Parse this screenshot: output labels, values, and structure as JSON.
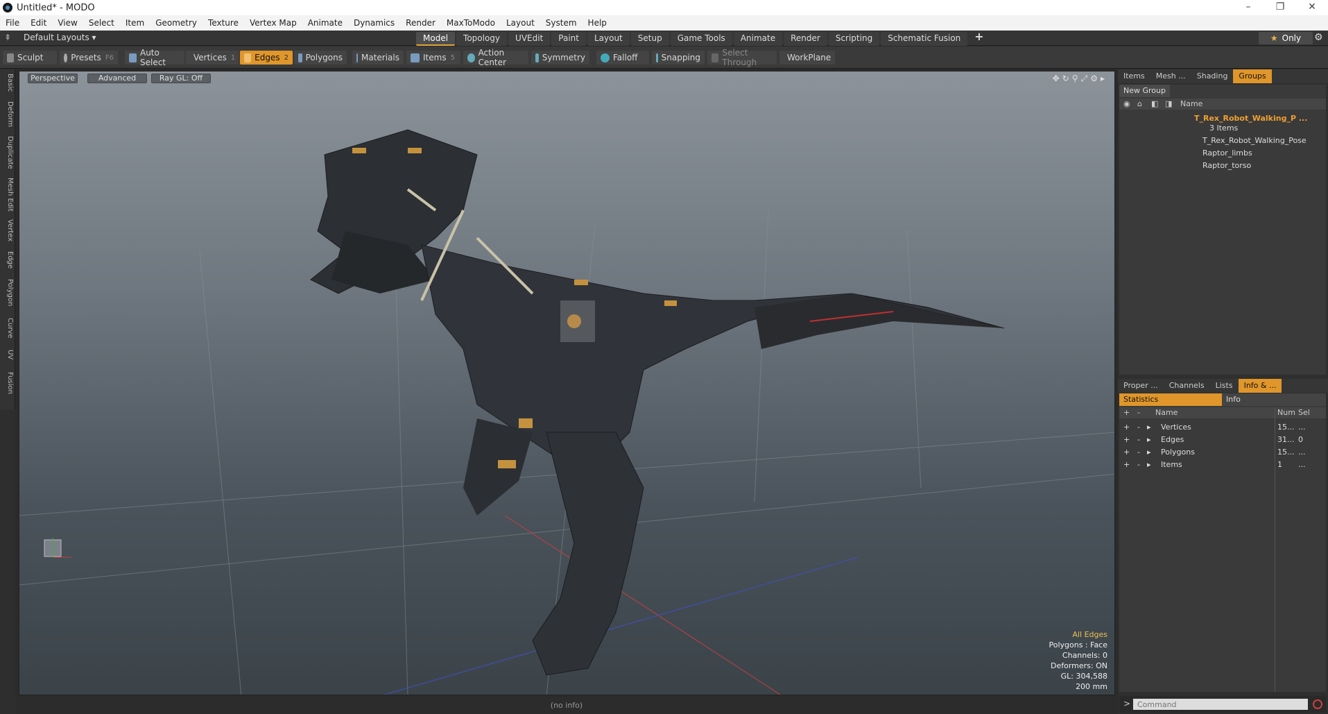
{
  "window": {
    "title": "Untitled* - MODO",
    "min": "–",
    "max": "❐",
    "close": "✕"
  },
  "menu": [
    "File",
    "Edit",
    "View",
    "Select",
    "Item",
    "Geometry",
    "Texture",
    "Vertex Map",
    "Animate",
    "Dynamics",
    "Render",
    "MaxToModo",
    "Layout",
    "System",
    "Help"
  ],
  "layouts": {
    "label": "Default Layouts ▾",
    "tabs": [
      "Model",
      "Topology",
      "UVEdit",
      "Paint",
      "Layout",
      "Setup",
      "Game Tools",
      "Animate",
      "Render",
      "Scripting",
      "Schematic Fusion"
    ],
    "active": "Model",
    "add": "+",
    "only": "Only"
  },
  "toolbar": {
    "sculpt": "Sculpt",
    "presets": "Presets",
    "presets_key": "F6",
    "auto_select": "Auto Select",
    "vertices": "Vertices",
    "vertices_num": "1",
    "edges": "Edges",
    "edges_num": "2",
    "polygons": "Polygons",
    "materials": "Materials",
    "items": "Items",
    "items_num": "5",
    "action_center": "Action Center",
    "symmetry": "Symmetry",
    "falloff": "Falloff",
    "snapping": "Snapping",
    "select_through": "Select Through",
    "workplane": "WorkPlane"
  },
  "lefttabs": [
    "Basic",
    "Deform",
    "Duplicate",
    "Mesh Edit",
    "Vertex",
    "Edge",
    "Polygon",
    "Curve",
    "UV",
    "Fusion"
  ],
  "viewport": {
    "perspective": "Perspective",
    "advanced": "Advanced",
    "raygl": "Ray GL: Off",
    "stats": {
      "all_edges": "All Edges",
      "polygons": "Polygons : Face",
      "channels": "Channels: 0",
      "deformers": "Deformers: ON",
      "gl": "GL: 304,588",
      "scale": "200 mm"
    }
  },
  "status": "(no info)",
  "groups_panel": {
    "tabs": [
      "Items",
      "Mesh ...",
      "Shading",
      "Groups"
    ],
    "active": "Groups",
    "new_group": "New Group",
    "name_col": "Name",
    "group_name": "T_Rex_Robot_Walking_P ...",
    "group_count": "3 Items",
    "children": [
      "T_Rex_Robot_Walking_Pose",
      "Raptor_limbs",
      "Raptor_torso"
    ]
  },
  "info_panel": {
    "tabs": [
      "Proper ...",
      "Channels",
      "Lists",
      "Info & ..."
    ],
    "active": "Info & ...",
    "statistics": "Statistics",
    "info": "Info",
    "cols": {
      "plus": "+",
      "minus": "-",
      "name": "Name",
      "num": "Num",
      "sel": "Sel"
    },
    "rows": [
      {
        "name": "Vertices",
        "num": "15...",
        "sel": "..."
      },
      {
        "name": "Edges",
        "num": "31...",
        "sel": "0"
      },
      {
        "name": "Polygons",
        "num": "15...",
        "sel": "..."
      },
      {
        "name": "Items",
        "num": "1",
        "sel": "..."
      }
    ],
    "command_placeholder": "Command"
  }
}
